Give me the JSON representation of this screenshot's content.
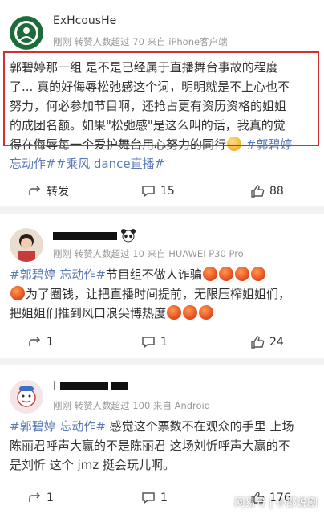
{
  "post1": {
    "username": "ExHcousHe",
    "meta": "刚刚  转赞人数超过 70  来自 iPhone客户端",
    "text_lines": [
      "郭碧婷那一组 是不是已经属于直播舞台事故的程度",
      "了... 真的好侮辱松弛感这个词，明明就是不上心也不",
      "努力，何必参加节目啊，还抢占更有资历资格的姐姐",
      "的成团名额。如果\"松弛感\"是这么叫的话，我真的觉",
      "得在侮辱每一个爱护舞台用心努力的同行"
    ],
    "tag_tail": " #郭碧婷",
    "tag_line": "忘动作##乘风 dance直播#",
    "forward_label": "转发",
    "comments": "15",
    "likes": "88"
  },
  "post2": {
    "username": "",
    "meta": "刚刚  转赞人数超过 10  来自 HUAWEI P30 Pro",
    "tag_line": "#郭碧婷 忘动作#",
    "line1_rest": "节目组不做人诈骗",
    "line2": "为了圈钱，让把直播时间提前，无限压榨姐姐们，",
    "line3": "把姐姐们推到风口浪尖博热度",
    "forwards": "1",
    "comments": "1",
    "likes": "24"
  },
  "post3": {
    "username": "I",
    "meta": "刚刚  转赞人数超过 100  来自 Android",
    "tag_line": "#郭碧婷 忘动作#",
    "line1_rest": " 感觉这个票数不在观众的手里 上场",
    "line2": "陈丽君呼声大赢的不是陈丽君 这场刘忻呼声大赢的不",
    "line3": "是刘忻 这个 jmz 挺会玩儿啊。",
    "forwards": "1",
    "comments": "1",
    "likes": "176"
  },
  "watermark": "网易号 | 小邵说剧",
  "colors": {
    "tag": "#5a7ab5",
    "highlight_box": "#d62e2e",
    "meta": "#999999"
  }
}
